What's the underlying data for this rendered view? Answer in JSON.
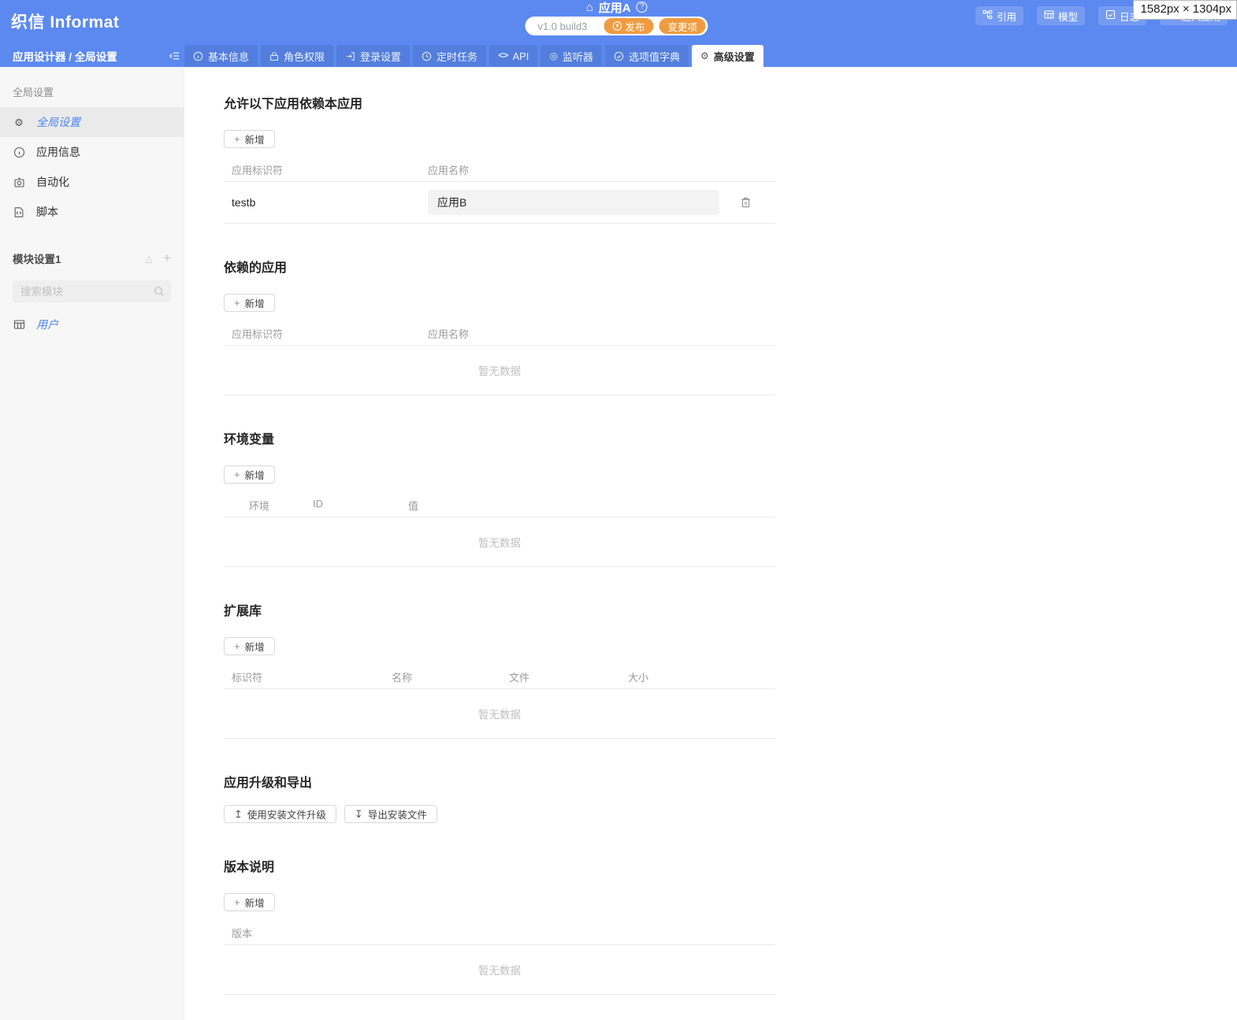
{
  "viewport_badge": "1582px × 1304px",
  "icons": {
    "gear": "⚙",
    "home": "⌂",
    "listener": "◎",
    "triangle": "△",
    "plus": "+",
    "api": "<>",
    "question": "?",
    "upload": "↥",
    "download": "↧"
  },
  "header": {
    "logo": "织信 Informat",
    "app_name": "应用A",
    "version": "v1.0 build3",
    "publish_label": "发布",
    "changes_label": "变更项",
    "actions": [
      {
        "label": "引用"
      },
      {
        "label": "模型"
      },
      {
        "label": "日志"
      },
      {
        "label": "进入应用"
      }
    ]
  },
  "nav": {
    "breadcrumb": "应用设计器 / 全局设置",
    "tabs": [
      {
        "label": "基本信息"
      },
      {
        "label": "角色权限"
      },
      {
        "label": "登录设置"
      },
      {
        "label": "定时任务"
      },
      {
        "label": "API"
      },
      {
        "label": "监听器"
      },
      {
        "label": "选项值字典"
      },
      {
        "label": "高级设置"
      }
    ]
  },
  "sidebar": {
    "group1_label": "全局设置",
    "items": [
      {
        "label": "全局设置"
      },
      {
        "label": "应用信息"
      },
      {
        "label": "自动化"
      },
      {
        "label": "脚本"
      }
    ],
    "group2_label": "模块设置1",
    "search_placeholder": "搜索模块",
    "module_items": [
      {
        "label": "用户"
      }
    ]
  },
  "main": {
    "add_label": "新增",
    "empty_label": "暂无数据",
    "sections": [
      {
        "title": "允许以下应用依赖本应用",
        "columns": [
          "应用标识符",
          "应用名称"
        ],
        "rows": [
          {
            "id": "testb",
            "name": "应用B"
          }
        ]
      },
      {
        "title": "依赖的应用",
        "columns": [
          "应用标识符",
          "应用名称"
        ],
        "empty": "暂无数据"
      },
      {
        "title": "环境变量",
        "columns": [
          "环境",
          "ID",
          "值"
        ],
        "empty": "暂无数据"
      },
      {
        "title": "扩展库",
        "columns": [
          "标识符",
          "名称",
          "文件",
          "大小"
        ],
        "empty": "暂无数据"
      },
      {
        "title": "应用升级和导出",
        "buttons": [
          {
            "label": "使用安装文件升级"
          },
          {
            "label": "导出安装文件"
          }
        ]
      },
      {
        "title": "版本说明",
        "columns": [
          "版本"
        ],
        "empty": "暂无数据"
      }
    ]
  }
}
